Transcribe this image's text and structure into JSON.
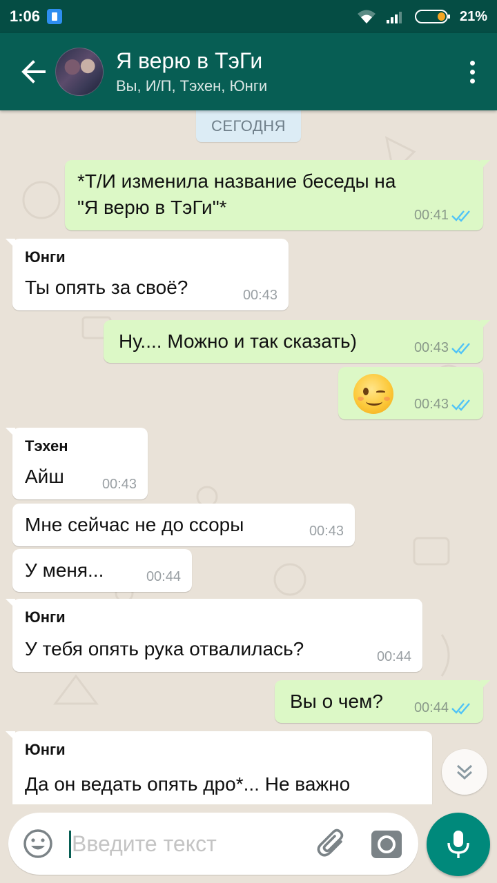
{
  "status_bar": {
    "time": "1:06",
    "battery_percent": "21%"
  },
  "header": {
    "title": "Я верю в ТэГи",
    "subtitle": "Вы, И/П, Тэхен, Юнги"
  },
  "chat": {
    "date_divider": "СЕГОДНЯ",
    "messages": [
      {
        "direction": "out",
        "lines": "*Т/И изменила название беседы на\n\"Я верю в ТэГи\"*",
        "time": "00:41",
        "status": "read"
      },
      {
        "direction": "in",
        "sender": "Юнги",
        "text": "Ты опять за своё?",
        "time": "00:43"
      },
      {
        "direction": "out",
        "text": "Ну.... Можно и так сказать)",
        "time": "00:43",
        "status": "read"
      },
      {
        "direction": "out",
        "emoji": "winking-face",
        "time": "00:43",
        "status": "read"
      },
      {
        "direction": "in",
        "sender": "Тэхен",
        "text": "Айш",
        "time": "00:43"
      },
      {
        "direction": "in",
        "text": "Мне сейчас не до ссоры",
        "time": "00:43"
      },
      {
        "direction": "in",
        "text": "У меня...",
        "time": "00:44"
      },
      {
        "direction": "in",
        "sender": "Юнги",
        "text": "У тебя опять рука отвалилась?",
        "time": "00:44"
      },
      {
        "direction": "out",
        "text": "Вы о чем?",
        "time": "00:44",
        "status": "read"
      },
      {
        "direction": "in",
        "sender": "Юнги",
        "text": "Да он ведать опять дро*... Не важно",
        "time": ""
      }
    ]
  },
  "input_bar": {
    "placeholder": "Введите текст",
    "value": ""
  },
  "colors": {
    "status_bar": "#054d44",
    "app_bar": "#075e54",
    "outgoing_bubble": "#dcf8c6",
    "incoming_bubble": "#ffffff",
    "read_ticks": "#4fc3f7",
    "mic_button": "#00897b",
    "wallpaper": "#e9e2d8"
  },
  "icons": {
    "back": "arrow-left-icon",
    "menu": "more-vert-icon",
    "scroll_down": "chevron-double-down-icon",
    "emoji": "smiley-icon",
    "attach": "paperclip-icon",
    "camera": "camera-icon",
    "mic": "microphone-icon",
    "read_status": "double-check-icon"
  }
}
